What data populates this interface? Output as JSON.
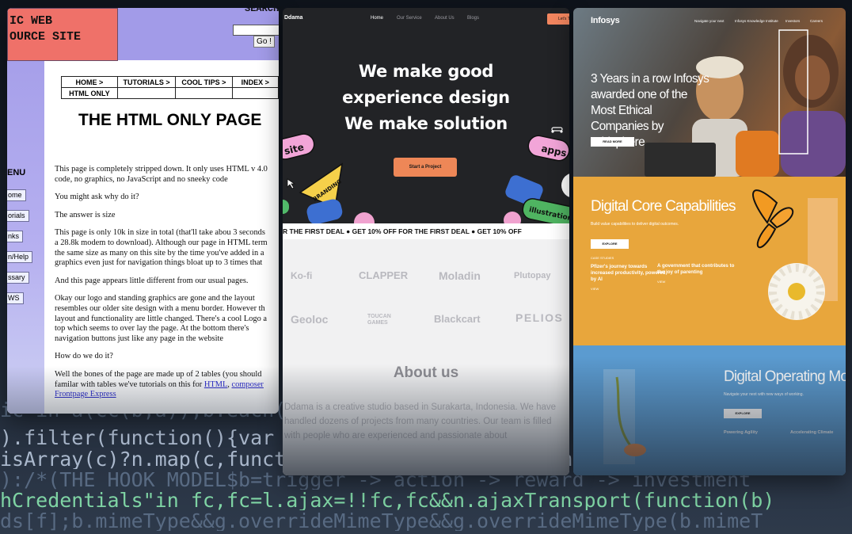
{
  "background": {
    "code_lines": [
      "ic in a(cc(b,a));b.each(c,function(a){ac(a",
      ").filter(function(){var a=this.type;return this.name",
      "isArray(c)?n.map(c,function(a){return{name:b.name,value:a.replace",
      "):/*(THE HOOK MODEL$b=trigger -> action -> reward -> investment",
      "hCredentials\"in fc,fc=l.ajax=!!fc,fc&&n.ajaxTransport(function(b)",
      "ds[f];b.mimeType&&g.overrideMimeType&&g.overrideMimeType(b.mimeT"
    ]
  },
  "panel1": {
    "logo_line1": "IC WEB",
    "logo_line2": "OURCE SITE",
    "search_label": "SEARCH",
    "go_button": "Go !",
    "nav": {
      "home": "HOME >",
      "tutorials": "TUTORIALS >",
      "cool_tips": "COOL TIPS >",
      "index": "INDEX >",
      "html_only": "HTML ONLY"
    },
    "title": "THE HTML ONLY PAGE",
    "menu_title": "ENU",
    "menu": [
      "ome",
      "orials",
      "nks",
      "n/Help",
      "ssary",
      "WS"
    ],
    "paragraphs": {
      "p1a": "This page is completely stripped down. It only uses HTML v 4.0",
      "p1b": "code, no graphics, no JavaScript and no sneeky code",
      "p2": "You might ask why do it?",
      "p3": "The answer is size",
      "p4a": "This page is only 10k in size in total (that'll take abou 3 seconds",
      "p4b": "a 28.8k modem to download). Although our page in HTML term",
      "p4c": "the same size as many on this site by the time you've added in a",
      "p4d": "graphics even just for navigation things bloat up to 3 times that",
      "p5": "And this page appears little different from our usual pages.",
      "p6a": "Okay our logo and standing graphics are gone and the layout",
      "p6b": "resembles our older site design with a menu border. However th",
      "p6c": "layout and functionality are little changed. There's a cool Logo a",
      "p6d": "top which seems to over lay the page. At the bottom there's",
      "p6e": "navigation buttons just like any page in the website",
      "p7": "How do we do it?",
      "p8a": "Well the bones of the page are made up of 2 tables (you should",
      "p8b_pre": "familar with tables we've tutorials on this for ",
      "p8b_link1": "HTML",
      "p8b_mid": ", ",
      "p8b_link2": "composer",
      "p8c_link": "Frontpage Express"
    }
  },
  "panel2": {
    "brand": "Ddama",
    "nav": [
      "Home",
      "Our Service",
      "About Us",
      "Blogs"
    ],
    "cta_header": "Let's T",
    "hero_line1": "We make good",
    "hero_line2": "experience design",
    "hero_line3": "We make solution",
    "cta": "Start a Project",
    "stickers": {
      "site": "site",
      "apps": "apps",
      "illustration": "illustration",
      "branding": "BRANDING"
    },
    "marquee": "R THE FIRST DEAL   ●  GET  10% OFF FOR THE FIRST DEAL   ●  GET  10% OFF",
    "partners": [
      "Ko-fi",
      "CLAPPER",
      "Moladin",
      "Plutopay",
      "Geoloc",
      "TOUCAN GAMES",
      "Blackcart",
      "PELIOS"
    ],
    "about_title": "About us",
    "about_line1": "Ddama is a creative studio based in Surakarta, Indonesia. We have",
    "about_line2": "handled dozens of projects from many countries.  Our team is filled",
    "about_line3": "with people who are experienced and passionate about"
  },
  "panel3": {
    "brand": "Infosys",
    "nav": [
      "Navigate your next",
      "Infosys Knowledge Institute",
      "Investors",
      "Careers"
    ],
    "hero_title": "3 Years in a row Infosys awarded one of the Most Ethical Companies by Ethisphere",
    "read_more": "READ MORE",
    "section2_title": "Digital Core Capabilities",
    "section2_sub": "Build value capabilities to deliver digital outcomes.",
    "explore": "EXPLORE",
    "card1_label": "CASE STUDIES",
    "card1_title": "Pfizer's journey towards increased productivity, powered by AI",
    "card1_view": "VIEW",
    "card2_title": "A government that contributes to the joy of parenting",
    "card2_view": "VIEW",
    "section3_title": "Digital Operating Models",
    "section3_sub": "Navigate your next with new ways of working.",
    "explore3": "EXPLORE",
    "card3_title": "Powering Agility",
    "card4_title": "Accelerating Climate"
  },
  "colors": {
    "p1_logo": "#ef7169",
    "p1_lavender": "#a29be8",
    "p2_accent": "#ee8757",
    "p3_orange": "#e8a63c",
    "p3_blue": "#5b9bd0"
  }
}
